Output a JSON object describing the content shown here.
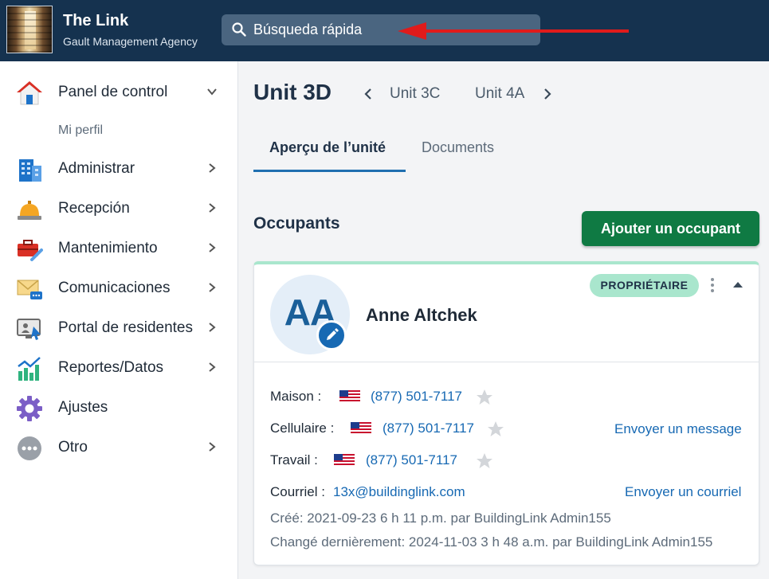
{
  "header": {
    "app_title": "The Link",
    "app_subtitle": "Gault Management Agency",
    "search_placeholder": "Búsqueda rápida",
    "colors": {
      "background": "#15324f",
      "search_bg": "#4a6580",
      "annotation_arrow": "#e01b1b"
    }
  },
  "sidebar": {
    "items": [
      {
        "label": "Panel de control",
        "icon": "house-icon",
        "chevron": "down"
      },
      {
        "label": "Administrar",
        "icon": "building-icon",
        "chevron": "right"
      },
      {
        "label": "Recepción",
        "icon": "service-bell-icon",
        "chevron": "right"
      },
      {
        "label": "Mantenimiento",
        "icon": "toolbox-icon",
        "chevron": "right"
      },
      {
        "label": "Comunicaciones",
        "icon": "envelope-chat-icon",
        "chevron": "right"
      },
      {
        "label": "Portal de residentes",
        "icon": "resident-portal-icon",
        "chevron": "right"
      },
      {
        "label": "Reportes/Datos",
        "icon": "bar-chart-icon",
        "chevron": "right"
      },
      {
        "label": "Ajustes",
        "icon": "gear-icon",
        "chevron": "none"
      },
      {
        "label": "Otro",
        "icon": "more-dots-icon",
        "chevron": "right"
      }
    ],
    "sub_item": "Mi perfil"
  },
  "unit": {
    "title": "Unit 3D",
    "prev_unit": "Unit 3C",
    "next_unit": "Unit 4A"
  },
  "tabs": {
    "overview": "Aperçu de l’unité",
    "documents": "Documents"
  },
  "occupants": {
    "section_title": "Occupants",
    "add_button": "Ajouter un occupant",
    "card": {
      "initials": "AA",
      "name": "Anne Altchek",
      "badge": "PROPRIÉTAIRE",
      "home_label": "Maison :",
      "home_phone": "(877) 501-7117",
      "cell_label": "Cellulaire :",
      "cell_phone": "(877) 501-7117",
      "work_label": "Travail :",
      "work_phone": "(877) 501-7117",
      "send_message": "Envoyer un message",
      "email_label": "Courriel :",
      "email": "13x@buildinglink.com",
      "send_email": "Envoyer un courriel",
      "created": "Créé:  2021-09-23 6 h 11 p.m. par BuildingLink Admin155",
      "changed": "Changé dernièrement:  2024-11-03 3 h 48 a.m. par BuildingLink Admin155"
    }
  }
}
